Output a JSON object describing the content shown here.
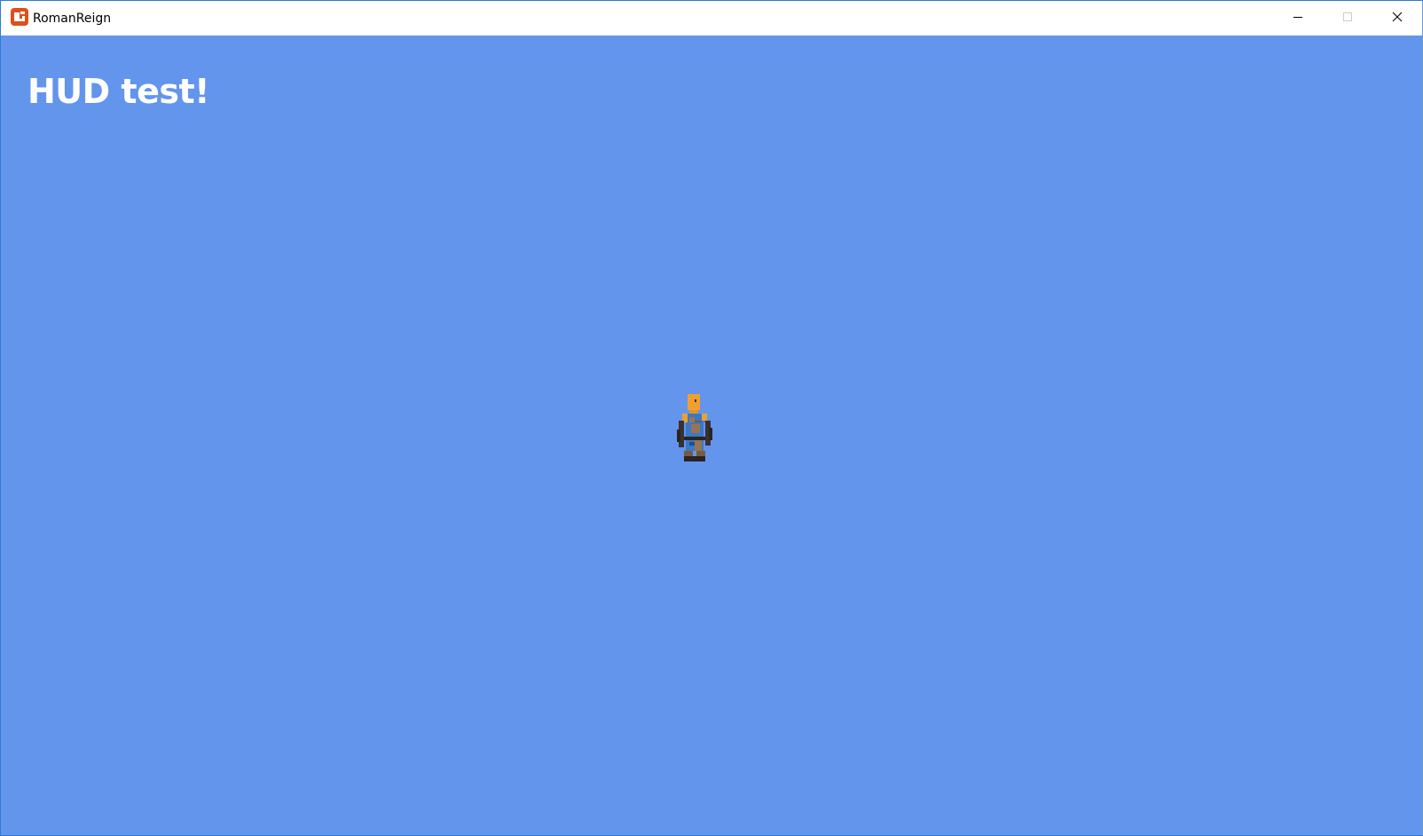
{
  "window": {
    "title": "RomanReign",
    "app_icon": "monogame-icon",
    "controls": {
      "minimize_icon": "minimize-icon",
      "maximize_icon": "maximize-icon",
      "close_icon": "close-icon"
    }
  },
  "game": {
    "hud_text": "HUD test!",
    "background_color": "#6495ed",
    "hud_text_color": "#ffffff",
    "player_sprite": "player-character-sprite"
  },
  "colors": {
    "icon_orange": "#e04e1b",
    "skin": "#f0a030",
    "tunic_blue": "#3a78c8",
    "dark": "#3a3030",
    "leather": "#9a7450"
  }
}
